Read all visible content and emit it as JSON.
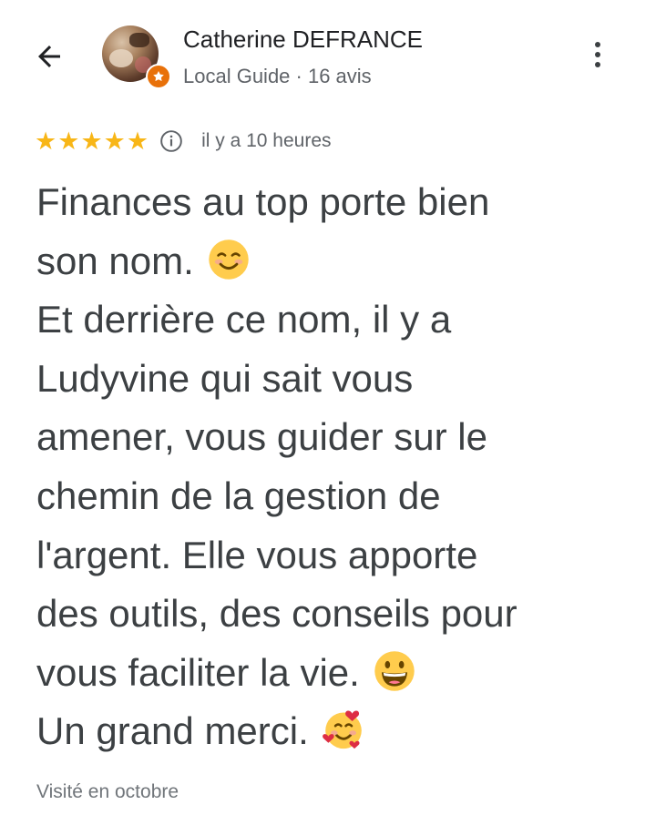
{
  "header": {
    "back_icon": "arrow-left-icon",
    "more_icon": "more-vert-icon"
  },
  "reviewer": {
    "name": "Catherine DEFRANCE",
    "meta": "Local Guide · 16 avis",
    "badge_icon": "local-guide-star-icon",
    "badge_color": "#e8710a"
  },
  "rating": {
    "stars": 5,
    "star_color": "#f8b617",
    "info_icon": "info-icon",
    "time": "il y a 10 heures"
  },
  "review": {
    "lines": [
      "Finances au top porte bien",
      "son nom.",
      "Et derrière ce nom, il y a",
      "Ludyvine qui sait vous",
      "amener, vous guider sur le",
      "chemin de la gestion de",
      "l'argent. Elle vous apporte",
      "des outils, des conseils pour",
      "vous faciliter la vie.",
      "Un grand merci."
    ],
    "emojis": {
      "line_2": "smiling-face-emoji",
      "line_9": "grinning-face-emoji",
      "line_10": "smiling-face-with-hearts-emoji"
    }
  },
  "footer": {
    "visited": "Visité en octobre"
  }
}
